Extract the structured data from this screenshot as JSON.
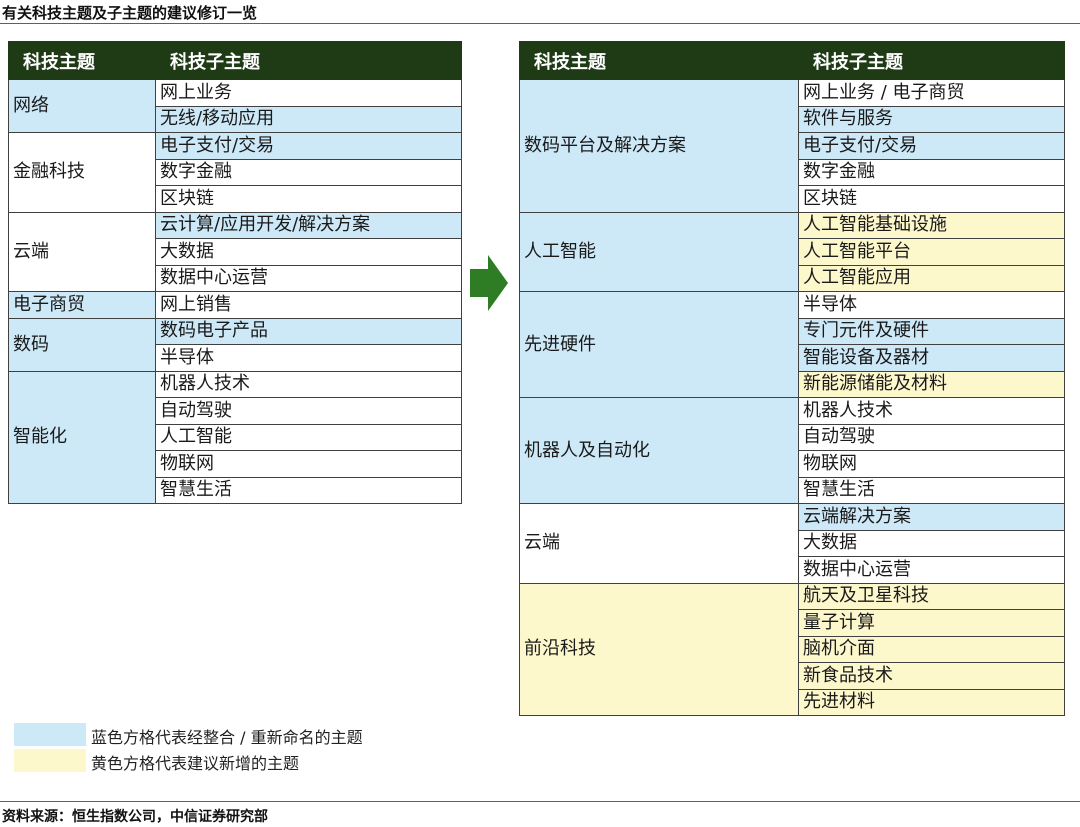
{
  "header": {
    "title": "有关科技主题及子主题的建议修订一览"
  },
  "colors": {
    "blue_cell": "#cde8f7",
    "yellow_cell": "#fdf7cc",
    "header_bg": "#1f3b15",
    "rule": "#c0392b",
    "arrow": "#2e7d24"
  },
  "icons": {
    "arrow": "right-arrow-icon"
  },
  "left_table": {
    "headers": [
      "科技主题",
      "科技子主题"
    ],
    "groups": [
      {
        "theme": "网络",
        "color": "blue",
        "subs": [
          {
            "text": "网上业务",
            "color": "white"
          },
          {
            "text": "无线/移动应用",
            "color": "blue"
          }
        ]
      },
      {
        "theme": "金融科技",
        "color": "white",
        "subs": [
          {
            "text": "电子支付/交易",
            "color": "blue"
          },
          {
            "text": "数字金融",
            "color": "white"
          },
          {
            "text": "区块链",
            "color": "white"
          }
        ]
      },
      {
        "theme": "云端",
        "color": "white",
        "subs": [
          {
            "text": "云计算/应用开发/解决方案",
            "color": "blue"
          },
          {
            "text": "大数据",
            "color": "white"
          },
          {
            "text": "数据中心运营",
            "color": "white"
          }
        ]
      },
      {
        "theme": "电子商贸",
        "color": "blue",
        "subs": [
          {
            "text": "网上销售",
            "color": "white"
          }
        ]
      },
      {
        "theme": "数码",
        "color": "blue",
        "subs": [
          {
            "text": "数码电子产品",
            "color": "blue"
          },
          {
            "text": "半导体",
            "color": "white"
          }
        ]
      },
      {
        "theme": "智能化",
        "color": "blue",
        "subs": [
          {
            "text": "机器人技术",
            "color": "white"
          },
          {
            "text": "自动驾驶",
            "color": "white"
          },
          {
            "text": "人工智能",
            "color": "white"
          },
          {
            "text": "物联网",
            "color": "white"
          },
          {
            "text": "智慧生活",
            "color": "white"
          }
        ]
      }
    ]
  },
  "right_table": {
    "headers": [
      "科技主题",
      "科技子主题"
    ],
    "groups": [
      {
        "theme": "数码平台及解决方案",
        "color": "blue",
        "subs": [
          {
            "text": "网上业务 / 电子商贸",
            "color": "white"
          },
          {
            "text": "软件与服务",
            "color": "blue"
          },
          {
            "text": "电子支付/交易",
            "color": "blue"
          },
          {
            "text": "数字金融",
            "color": "white"
          },
          {
            "text": "区块链",
            "color": "white"
          }
        ]
      },
      {
        "theme": "人工智能",
        "color": "blue",
        "subs": [
          {
            "text": "人工智能基础设施",
            "color": "yellow"
          },
          {
            "text": "人工智能平台",
            "color": "yellow"
          },
          {
            "text": "人工智能应用",
            "color": "yellow"
          }
        ]
      },
      {
        "theme": "先进硬件",
        "color": "blue",
        "subs": [
          {
            "text": "半导体",
            "color": "white"
          },
          {
            "text": "专门元件及硬件",
            "color": "blue"
          },
          {
            "text": "智能设备及器材",
            "color": "blue"
          },
          {
            "text": "新能源储能及材料",
            "color": "yellow"
          }
        ]
      },
      {
        "theme": "机器人及自动化",
        "color": "blue",
        "subs": [
          {
            "text": "机器人技术",
            "color": "white"
          },
          {
            "text": "自动驾驶",
            "color": "white"
          },
          {
            "text": "物联网",
            "color": "white"
          },
          {
            "text": "智慧生活",
            "color": "white"
          }
        ]
      },
      {
        "theme": "云端",
        "color": "white",
        "subs": [
          {
            "text": "云端解决方案",
            "color": "blue"
          },
          {
            "text": "大数据",
            "color": "white"
          },
          {
            "text": "数据中心运营",
            "color": "white"
          }
        ]
      },
      {
        "theme": "前沿科技",
        "color": "yellow",
        "subs": [
          {
            "text": "航天及卫星科技",
            "color": "yellow"
          },
          {
            "text": "量子计算",
            "color": "yellow"
          },
          {
            "text": "脑机介面",
            "color": "yellow"
          },
          {
            "text": "新食品技术",
            "color": "yellow"
          },
          {
            "text": "先进材料",
            "color": "yellow"
          }
        ]
      }
    ]
  },
  "legend": {
    "blue": "蓝色方格代表经整合 / 重新命名的主题",
    "yellow": "黄色方格代表建议新增的主题"
  },
  "footer": {
    "source": "资料来源：恒生指数公司，中信证券研究部"
  }
}
